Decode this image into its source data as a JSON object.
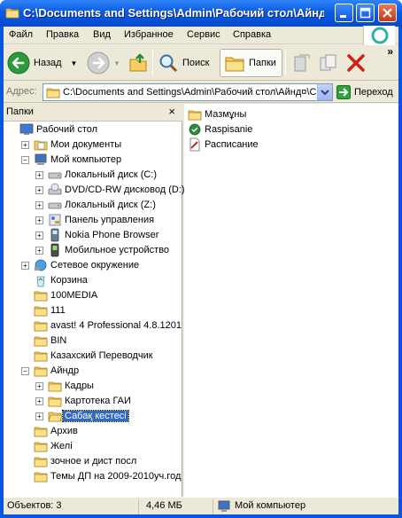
{
  "window": {
    "title": "C:\\Documents and Settings\\Admin\\Рабочий стол\\Айнд¤\\..."
  },
  "menu": [
    "Файл",
    "Правка",
    "Вид",
    "Избранное",
    "Сервис",
    "Справка"
  ],
  "toolbar": {
    "back": "Назад",
    "search": "Поиск",
    "folders": "Папки"
  },
  "address": {
    "label": "Адрес:",
    "value": "C:\\Documents and Settings\\Admin\\Рабочий стол\\Айнд¤\\С",
    "go": "Переход"
  },
  "tree_pane": {
    "header": "Папки",
    "close": "×",
    "items": [
      {
        "label": "Рабочий стол",
        "icon": "desktop-icon"
      },
      {
        "label": "Мои документы",
        "icon": "my-documents-icon"
      },
      {
        "label": "Мой компьютер",
        "icon": "my-computer-icon"
      },
      {
        "label": "Локальный диск (C:)",
        "icon": "hard-drive-icon"
      },
      {
        "label": "DVD/CD-RW дисковод (D:)",
        "icon": "dvd-drive-icon"
      },
      {
        "label": "Локальный диск (Z:)",
        "icon": "hard-drive-icon"
      },
      {
        "label": "Панель управления",
        "icon": "control-panel-icon"
      },
      {
        "label": "Nokia Phone Browser",
        "icon": "phone-icon"
      },
      {
        "label": "Мобильное устройство",
        "icon": "mobile-device-icon"
      },
      {
        "label": "Сетевое окружение",
        "icon": "network-icon"
      },
      {
        "label": "Корзина",
        "icon": "recycle-bin-icon"
      },
      {
        "label": "100MEDIA",
        "icon": "folder-icon"
      },
      {
        "label": "111",
        "icon": "folder-icon"
      },
      {
        "label": "avast! 4 Professional 4.8.1201",
        "icon": "folder-icon"
      },
      {
        "label": "BIN",
        "icon": "folder-icon"
      },
      {
        "label": "Казахский Переводчик",
        "icon": "folder-icon"
      },
      {
        "label": "Айндр",
        "icon": "folder-icon"
      },
      {
        "label": "Кадры",
        "icon": "folder-icon"
      },
      {
        "label": "Картотека ГАИ",
        "icon": "folder-icon"
      },
      {
        "label": "Сабақ кестесі",
        "icon": "folder-open-icon"
      },
      {
        "label": "Архив",
        "icon": "folder-icon"
      },
      {
        "label": "Желі",
        "icon": "folder-icon"
      },
      {
        "label": "зочное и дист посл",
        "icon": "folder-icon"
      },
      {
        "label": "Темы ДП на 2009-2010уч.год",
        "icon": "folder-icon"
      }
    ]
  },
  "files": [
    {
      "label": "Мазмұны",
      "icon": "folder-icon"
    },
    {
      "label": "Raspisanie",
      "icon": "program-icon"
    },
    {
      "label": "Расписание",
      "icon": "document-icon"
    }
  ],
  "status": {
    "objects": "Объектов: 3",
    "size": "4,46 МБ",
    "location": "Мой компьютер"
  }
}
